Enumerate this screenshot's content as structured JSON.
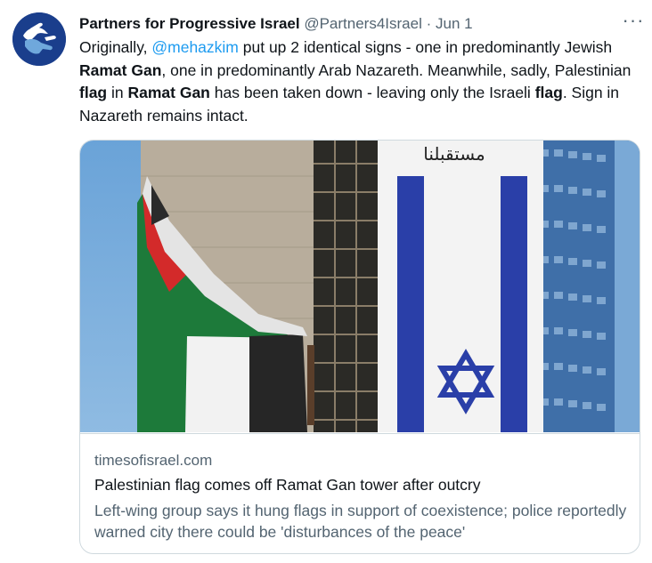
{
  "tweet": {
    "author_name": "Partners for Progressive Israel",
    "handle": "@Partners4Israel",
    "separator": "·",
    "date": "Jun 1",
    "more_label": "···",
    "text": {
      "p1": "Originally, ",
      "mention": "@mehazkim",
      "p2": " put up 2 identical signs - one in predominantly Jewish ",
      "b1": "Ramat Gan",
      "p3": ", one in predominantly Arab Nazareth. Meanwhile, sadly, Palestinian ",
      "b2": "flag",
      "p4": " in ",
      "b3": "Ramat Gan",
      "p5": " has been taken down - leaving only the Israeli ",
      "b4": "flag",
      "p6": ". Sign in Nazareth remains intact."
    }
  },
  "card": {
    "domain": "timesofisrael.com",
    "title": "Palestinian flag comes off Ramat Gan tower after outcry",
    "description": "Left-wing group says it hung flags in support of coexistence; police reportedly warned city there could be 'disturbances of the peace'",
    "banner_text": "مستقبلنا"
  },
  "colors": {
    "accent": "#1d9bf0",
    "secondary_text": "#536471",
    "border": "#cfd9de",
    "flag_blue": "#2a3fa8"
  }
}
